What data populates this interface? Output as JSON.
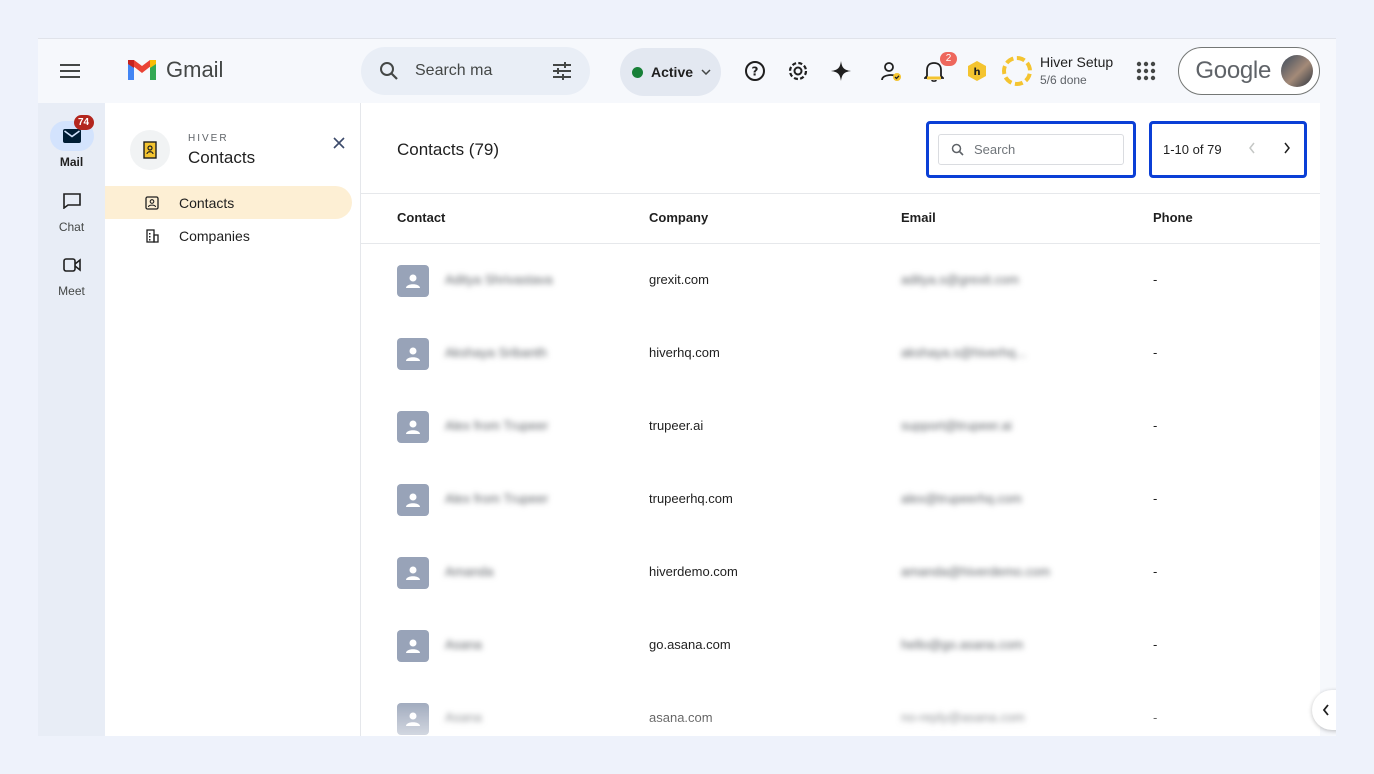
{
  "app": {
    "name": "Gmail"
  },
  "search": {
    "placeholder": "Search ma"
  },
  "status": {
    "label": "Active",
    "color": "#188038"
  },
  "notifications": {
    "count": "2"
  },
  "hiver_setup": {
    "title": "Hiver Setup",
    "progress": "5/6 done"
  },
  "account": {
    "brand": "Google"
  },
  "rail": {
    "items": [
      {
        "label": "Mail",
        "badge": "74",
        "icon": "mail-icon"
      },
      {
        "label": "Chat",
        "icon": "chat-icon"
      },
      {
        "label": "Meet",
        "icon": "video-icon"
      }
    ]
  },
  "panel": {
    "eyebrow": "HIVER",
    "title": "Contacts",
    "nav": [
      {
        "label": "Contacts",
        "icon": "contact-card-icon"
      },
      {
        "label": "Companies",
        "icon": "building-icon"
      }
    ]
  },
  "main": {
    "title": "Contacts (79)",
    "search_placeholder": "Search",
    "pagination": "1-10 of 79",
    "columns": [
      "Contact",
      "Company",
      "Email",
      "Phone"
    ],
    "rows": [
      {
        "name": "Aditya Shrivastava",
        "company": "grexit.com",
        "email": "aditya.s@grexit.com",
        "phone": "-"
      },
      {
        "name": "Akshaya Sribanth",
        "company": "hiverhq.com",
        "email": "akshaya.s@hiverhq...",
        "phone": "-"
      },
      {
        "name": "Alex from Trupeer",
        "company": "trupeer.ai",
        "email": "support@trupeer.ai",
        "phone": "-"
      },
      {
        "name": "Alex from Trupeer",
        "company": "trupeerhq.com",
        "email": "alex@trupeerhq.com",
        "phone": "-"
      },
      {
        "name": "Amanda",
        "company": "hiverdemo.com",
        "email": "amanda@hiverdemo.com",
        "phone": "-"
      },
      {
        "name": "Asana",
        "company": "go.asana.com",
        "email": "hello@go.asana.com",
        "phone": "-"
      },
      {
        "name": "Asana",
        "company": "asana.com",
        "email": "no-reply@asana.com",
        "phone": "-"
      }
    ]
  }
}
